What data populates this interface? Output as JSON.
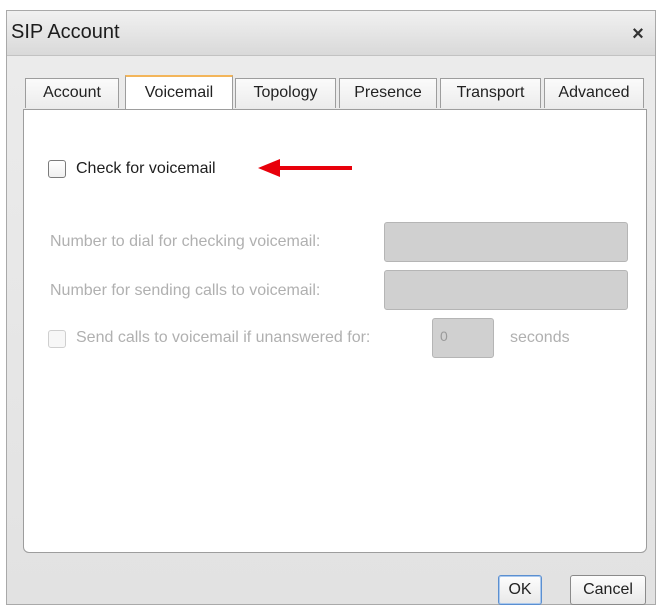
{
  "window": {
    "title": "SIP Account",
    "close_glyph": "×"
  },
  "tabs": [
    {
      "label": "Account",
      "active": false
    },
    {
      "label": "Voicemail",
      "active": true
    },
    {
      "label": "Topology",
      "active": false
    },
    {
      "label": "Presence",
      "active": false
    },
    {
      "label": "Transport",
      "active": false
    },
    {
      "label": "Advanced",
      "active": false
    }
  ],
  "voicemail": {
    "check_label": "Check for voicemail",
    "check_checked": false,
    "dial_label": "Number to dial for checking voicemail:",
    "dial_value": "",
    "send_label": "Number for sending calls to voicemail:",
    "send_value": "",
    "unanswered_label": "Send calls to voicemail if unanswered for:",
    "unanswered_checked": false,
    "seconds_value": "0",
    "seconds_label": "seconds"
  },
  "annotation": {
    "arrow_color": "#e8000b"
  },
  "buttons": {
    "ok": "OK",
    "cancel": "Cancel"
  }
}
